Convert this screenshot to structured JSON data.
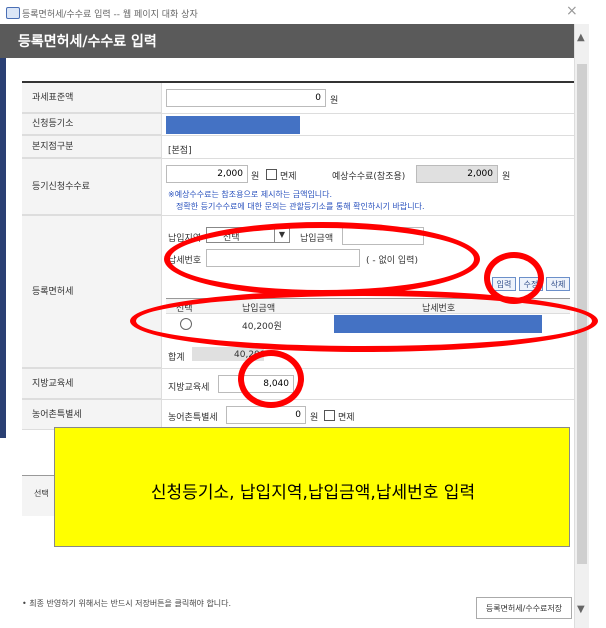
{
  "window": {
    "title": "등록면허세/수수료 입력 -- 웹 페이지 대화 상자",
    "close_label": "×"
  },
  "header": {
    "title": "등록면허세/수수료 입력"
  },
  "form": {
    "tax_base": {
      "label": "과세표준액",
      "value": "0",
      "unit": "원"
    },
    "registry_office": {
      "label": "신청등기소"
    },
    "main_branch": {
      "label": "본지점구분",
      "value": "[본점]"
    },
    "fee": {
      "label": "등기신청수수료",
      "value": "2,000",
      "unit": "원",
      "exempt_label": "면제",
      "expected_label": "예상수수료(참조용)",
      "expected_value": "2,000",
      "expected_unit": "원",
      "note1": "※예상수수료는 참조용으로 제시하는 금액입니다.",
      "note2": "정확한 등기수수료에 대한 문의는 관할등기소를 통해 확인하시기 바랍니다."
    },
    "registration_tax": {
      "label": "등록면허세",
      "region_label": "납입지역",
      "region_value": "선택",
      "amount_label": "납입금액",
      "tax_no_label": "납세번호",
      "tax_no_hint": "( - 없이 입력)",
      "btn_input": "입력",
      "btn_edit": "수정",
      "btn_delete": "삭제",
      "table_headers": [
        "선택",
        "납입금액",
        "납세번호"
      ],
      "rows": [
        {
          "amount": "40,200원"
        }
      ],
      "total_label": "합계",
      "total_value": "40,200"
    },
    "education_tax": {
      "label": "지방교육세",
      "field_label": "지방교육세",
      "value": "8,040"
    },
    "rural_tax": {
      "label": "농어촌특별세",
      "field_label": "농어촌특별세",
      "value": "0",
      "unit": "원",
      "exempt_label": "면제"
    }
  },
  "behind": {
    "select_label": "선택"
  },
  "callout": {
    "text": "신청등기소, 납입지역,납입금액,납세번호 입력"
  },
  "footer": {
    "note": "• 최종 반영하기 위해서는 반드시 저장버튼을 클릭해야 합니다.",
    "save_label": "등록면허세/수수료저장"
  },
  "colors": {
    "header_bg": "#5a5a5a",
    "highlight": "#4472c4",
    "annotation_red": "#ff0000",
    "callout_yellow": "#ffff00"
  }
}
